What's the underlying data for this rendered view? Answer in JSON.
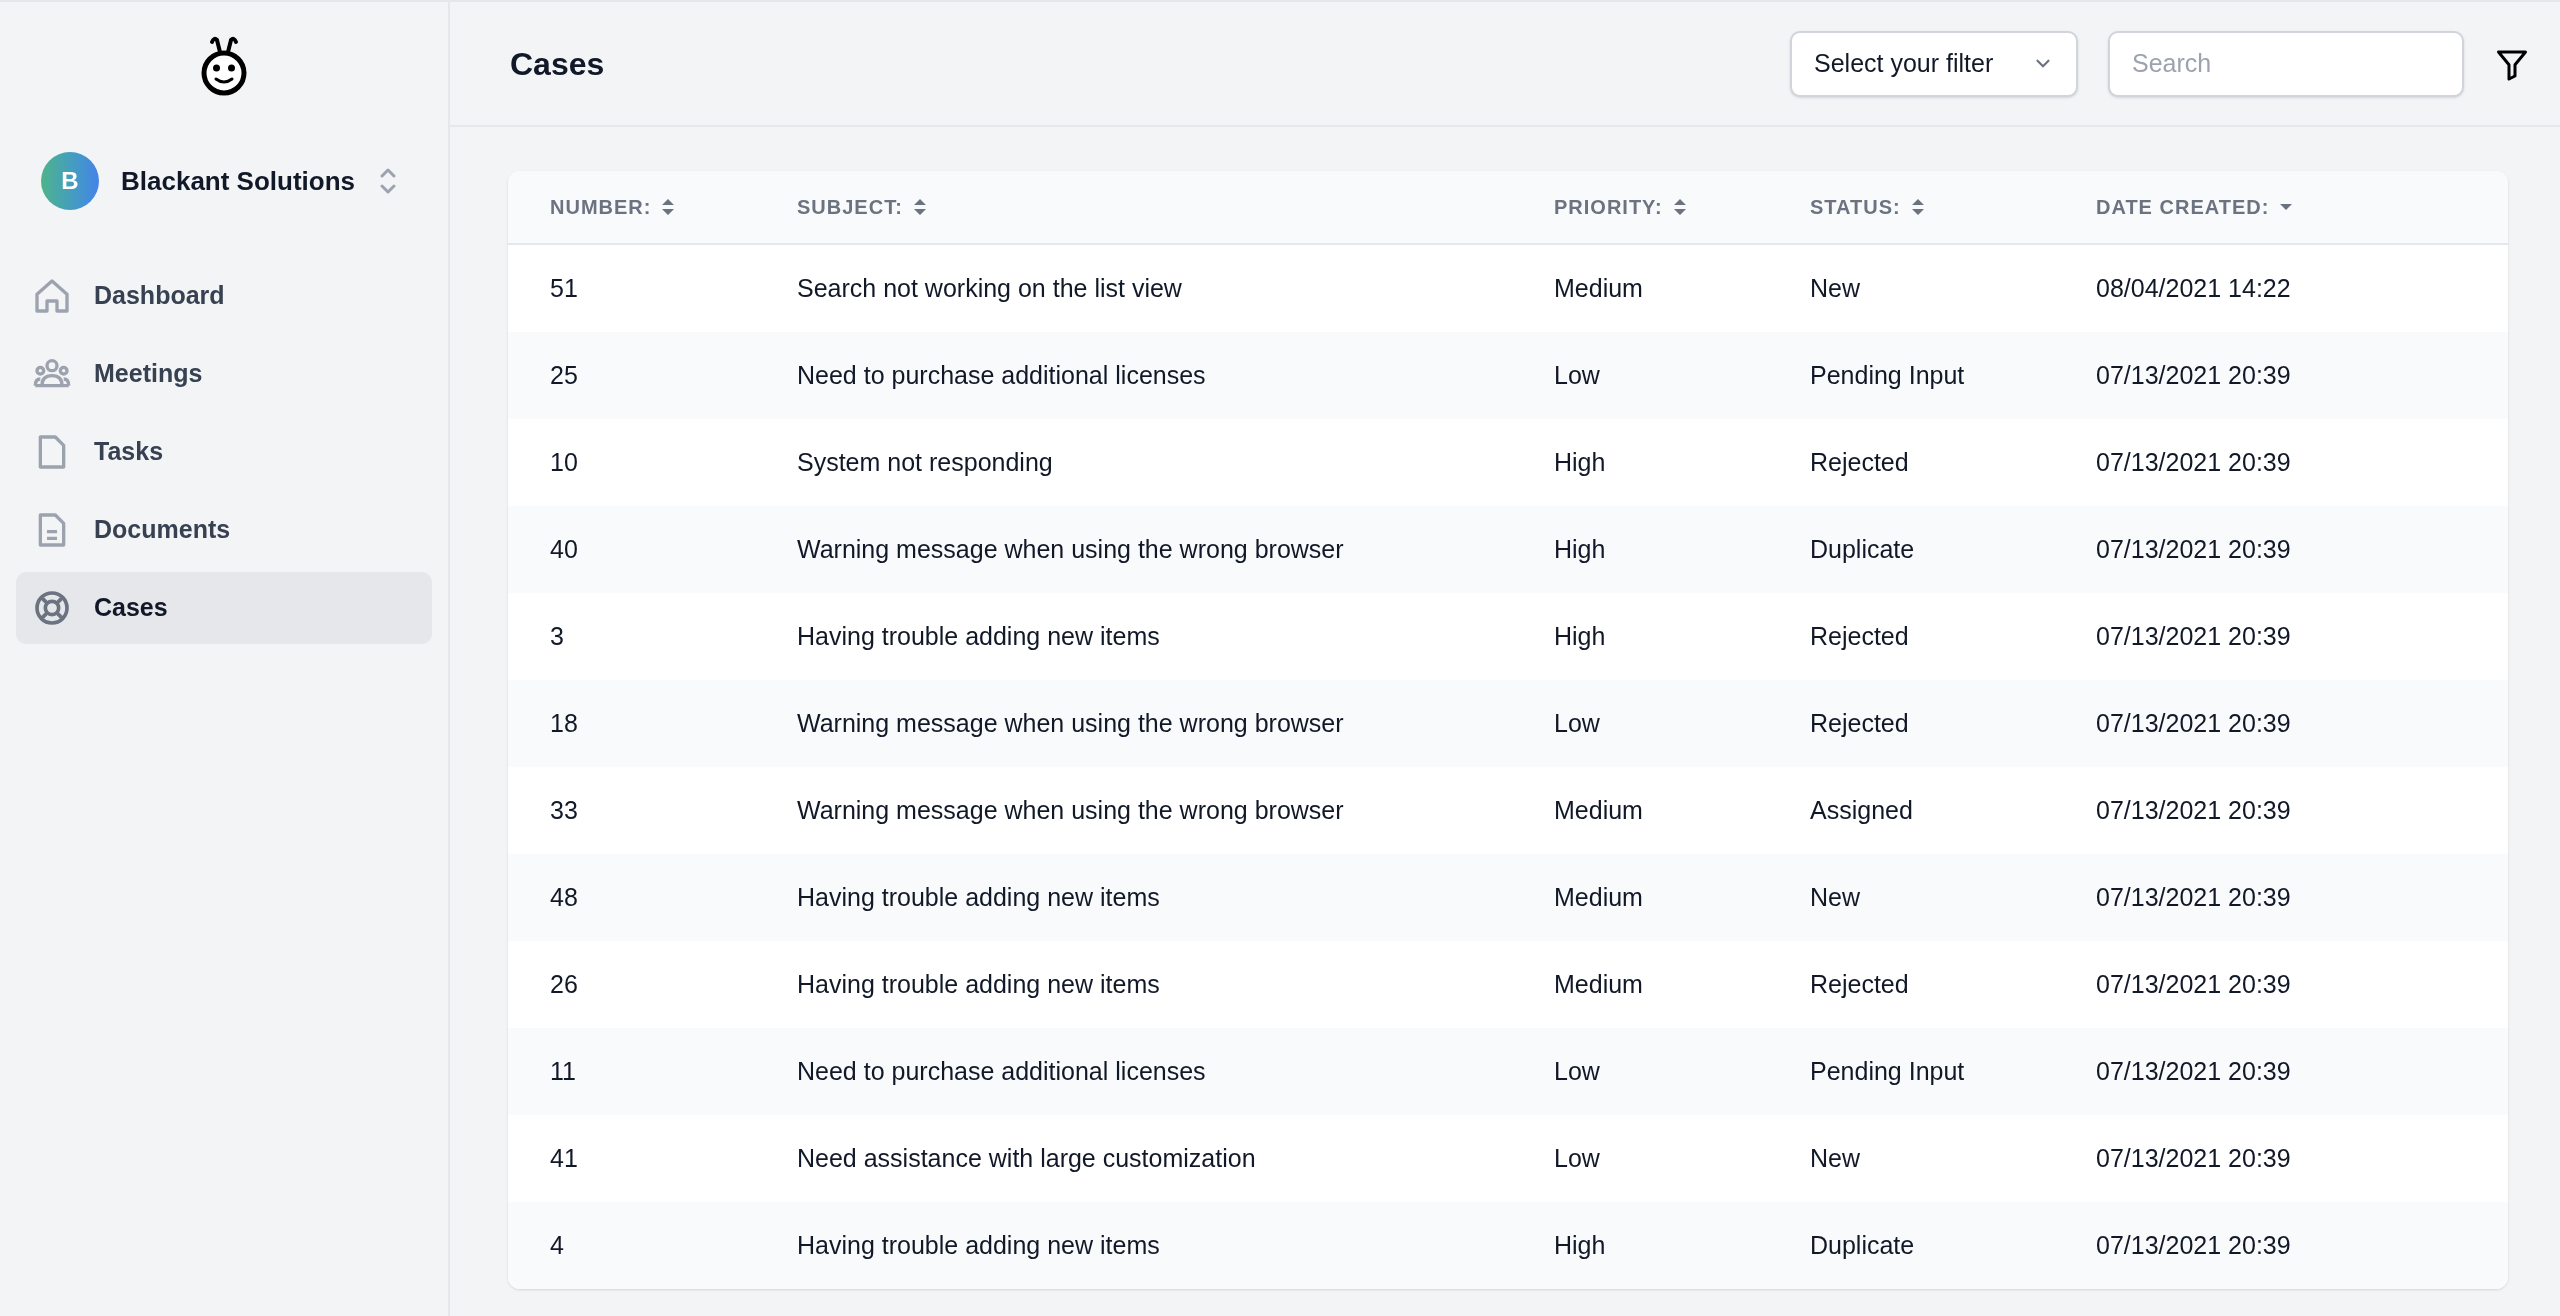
{
  "sidebar": {
    "org": {
      "initial": "B",
      "name": "Blackant Solutions"
    },
    "items": [
      {
        "label": "Dashboard",
        "kind": "home",
        "selected": false
      },
      {
        "label": "Meetings",
        "kind": "people",
        "selected": false
      },
      {
        "label": "Tasks",
        "kind": "file",
        "selected": false
      },
      {
        "label": "Documents",
        "kind": "document",
        "selected": false
      },
      {
        "label": "Cases",
        "kind": "lifebuoy",
        "selected": true
      }
    ]
  },
  "header": {
    "title": "Cases",
    "filter": {
      "value": "Select your filter"
    },
    "search": {
      "placeholder": "Search"
    }
  },
  "table": {
    "columns": [
      {
        "label": "NUMBER:",
        "sorted": false
      },
      {
        "label": "SUBJECT:",
        "sorted": false
      },
      {
        "label": "PRIORITY:",
        "sorted": false
      },
      {
        "label": "STATUS:",
        "sorted": false
      },
      {
        "label": "DATE CREATED:",
        "sorted": true
      }
    ],
    "rows": [
      [
        "51",
        "Search not working on the list view",
        "Medium",
        "New",
        "08/04/2021 14:22"
      ],
      [
        "25",
        "Need to purchase additional licenses",
        "Low",
        "Pending Input",
        "07/13/2021 20:39"
      ],
      [
        "10",
        "System not responding",
        "High",
        "Rejected",
        "07/13/2021 20:39"
      ],
      [
        "40",
        "Warning message when using the wrong browser",
        "High",
        "Duplicate",
        "07/13/2021 20:39"
      ],
      [
        "3",
        "Having trouble adding new items",
        "High",
        "Rejected",
        "07/13/2021 20:39"
      ],
      [
        "18",
        "Warning message when using the wrong browser",
        "Low",
        "Rejected",
        "07/13/2021 20:39"
      ],
      [
        "33",
        "Warning message when using the wrong browser",
        "Medium",
        "Assigned",
        "07/13/2021 20:39"
      ],
      [
        "48",
        "Having trouble adding new items",
        "Medium",
        "New",
        "07/13/2021 20:39"
      ],
      [
        "26",
        "Having trouble adding new items",
        "Medium",
        "Rejected",
        "07/13/2021 20:39"
      ],
      [
        "11",
        "Need to purchase additional licenses",
        "Low",
        "Pending Input",
        "07/13/2021 20:39"
      ],
      [
        "41",
        "Need assistance with large customization",
        "Low",
        "New",
        "07/13/2021 20:39"
      ],
      [
        "4",
        "Having trouble adding new items",
        "High",
        "Duplicate",
        "07/13/2021 20:39"
      ]
    ]
  }
}
